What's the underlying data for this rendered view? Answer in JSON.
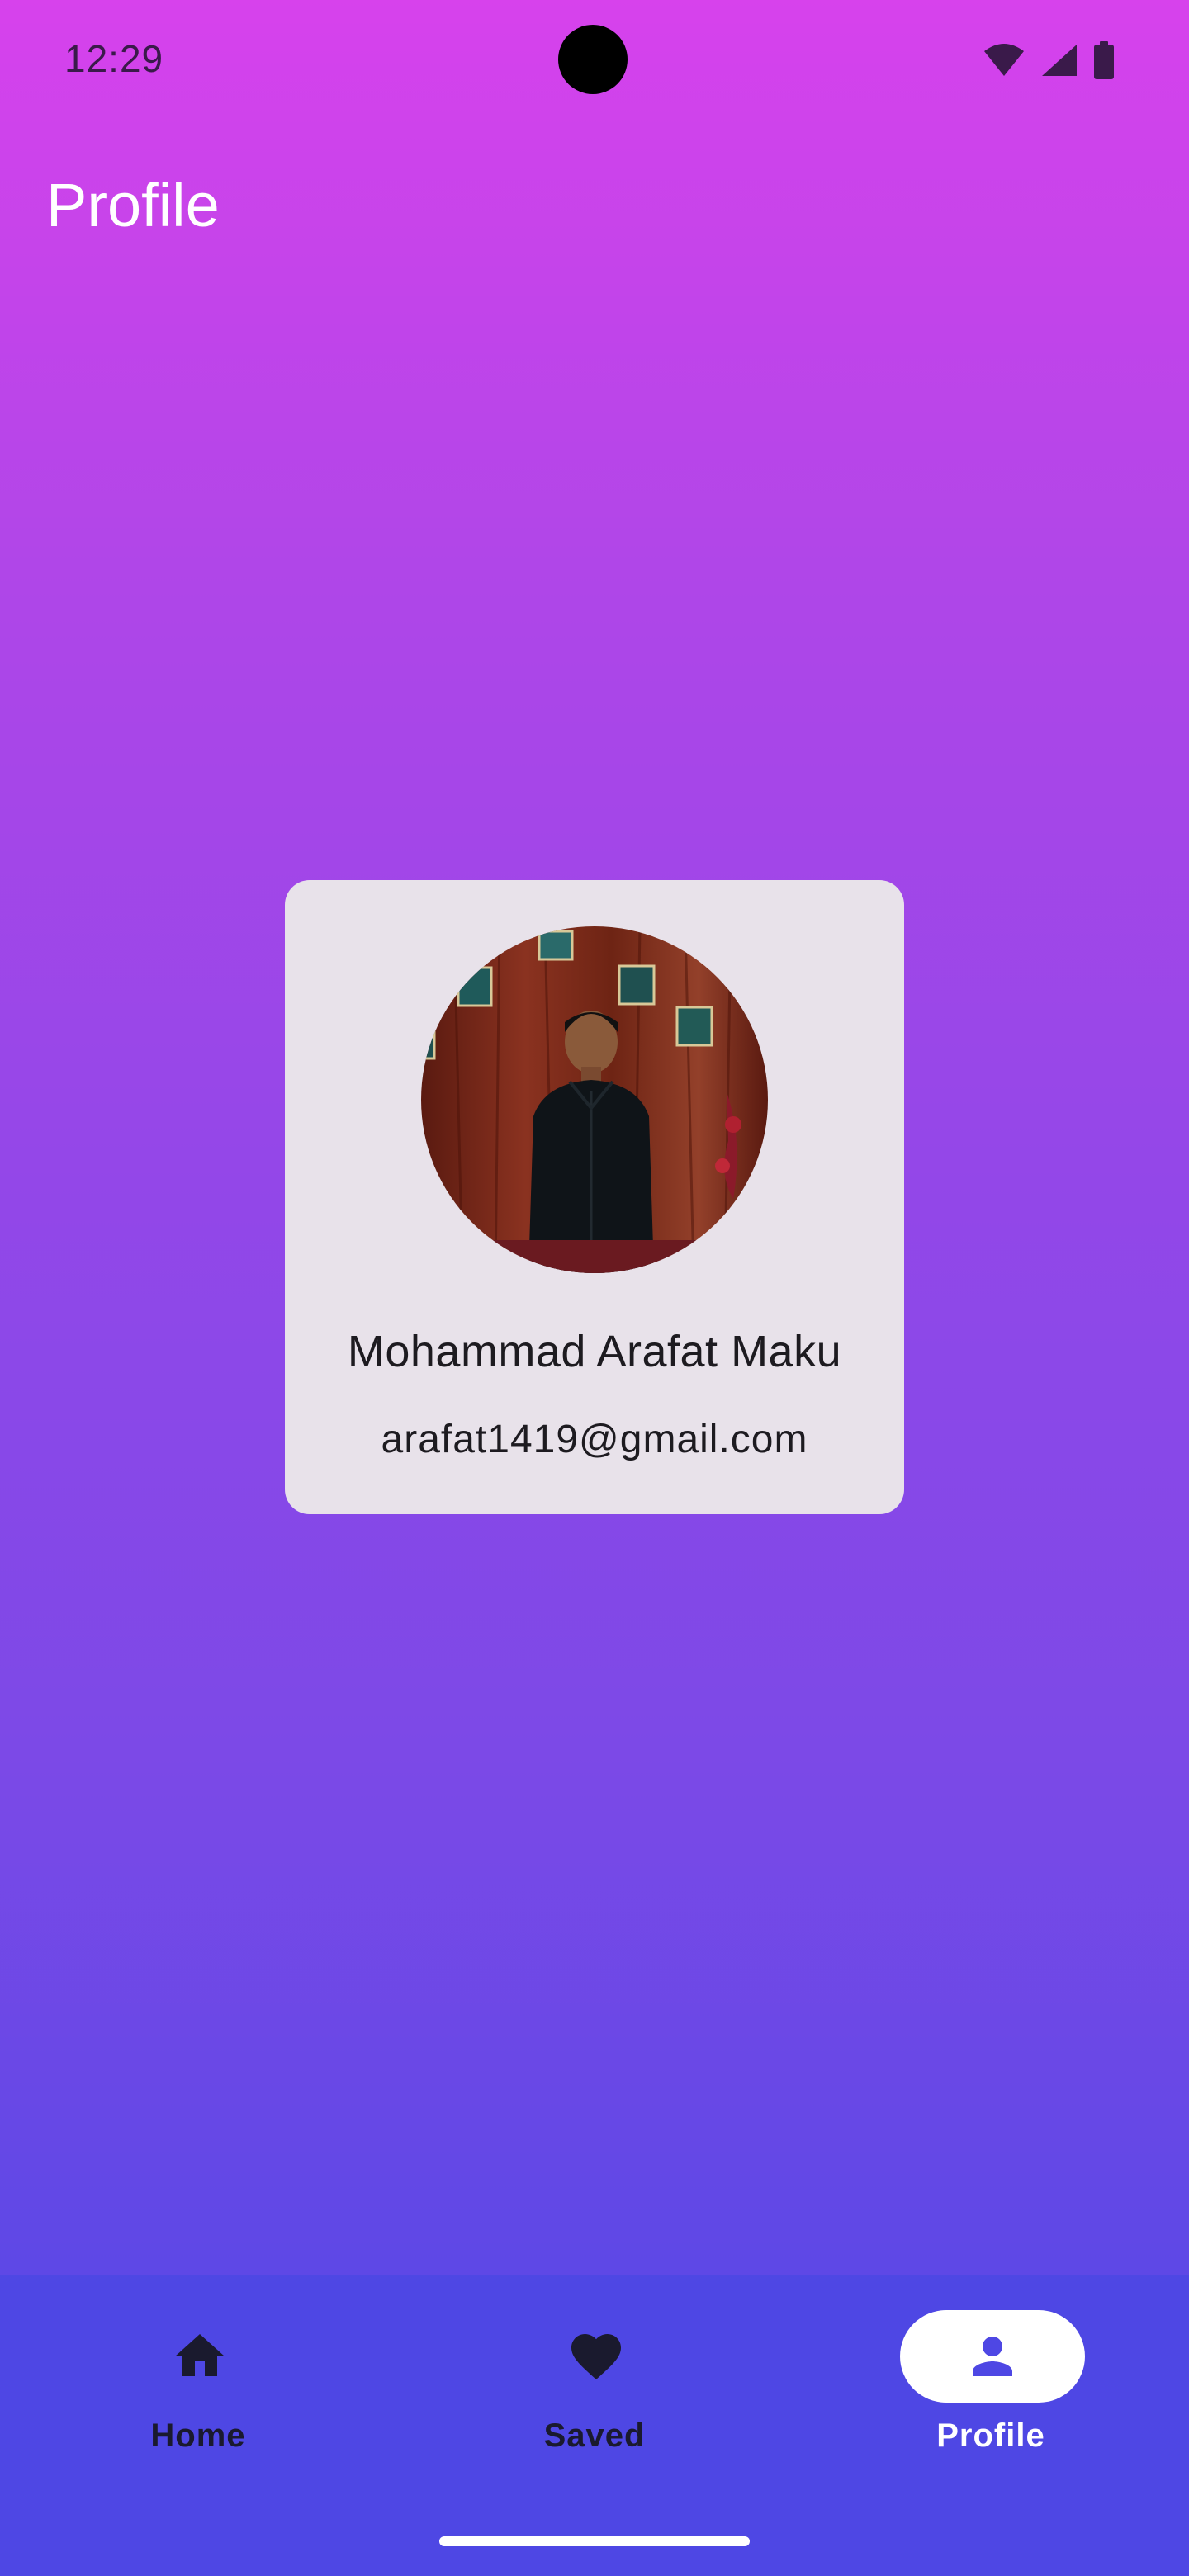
{
  "status_bar": {
    "time": "12:29",
    "icons": [
      "wifi-icon",
      "cellular-signal-icon",
      "battery-icon"
    ]
  },
  "app_bar": {
    "title": "Profile"
  },
  "profile": {
    "name": "Mohammad Arafat Maku",
    "email": "arafat1419@gmail.com",
    "avatar": "profile-photo"
  },
  "bottom_nav": {
    "items": [
      {
        "label": "Home",
        "icon": "home-icon",
        "active": false
      },
      {
        "label": "Saved",
        "icon": "heart-icon",
        "active": false
      },
      {
        "label": "Profile",
        "icon": "person-icon",
        "active": true
      }
    ]
  },
  "colors": {
    "gradient_top": "#D742EC",
    "gradient_bottom": "#5448E5",
    "card_bg": "#E8E2EA",
    "nav_bg": "#4E47E4",
    "active_indicator": "#FFFFFF",
    "active_icon": "#4E47E4",
    "inactive_icon": "#1A1A2E"
  }
}
